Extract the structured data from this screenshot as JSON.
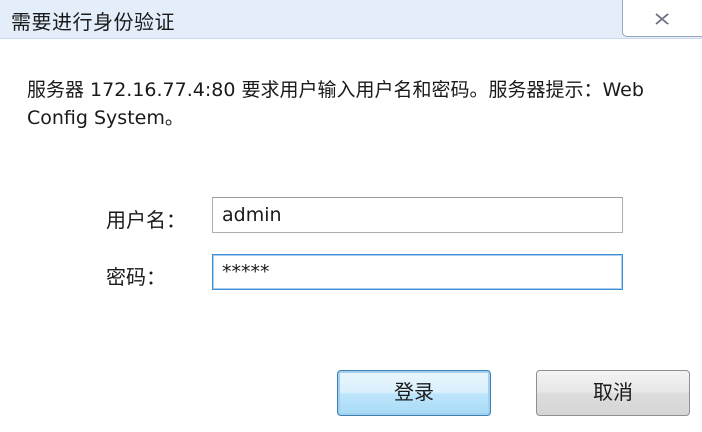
{
  "dialog": {
    "title": "需要进行身份验证",
    "close_icon": "close-icon",
    "message": "服务器 172.16.77.4:80 要求用户输入用户名和密码。服务器提示：Web Config System。"
  },
  "form": {
    "username_label": "用户名：",
    "username_value": "admin",
    "password_label": "密码：",
    "password_value": "*****"
  },
  "buttons": {
    "login_label": "登录",
    "cancel_label": "取消"
  },
  "colors": {
    "titlebar": "#e4eefb",
    "focus_border": "#3c8fd6",
    "default_button_border": "#3c7fb1"
  }
}
